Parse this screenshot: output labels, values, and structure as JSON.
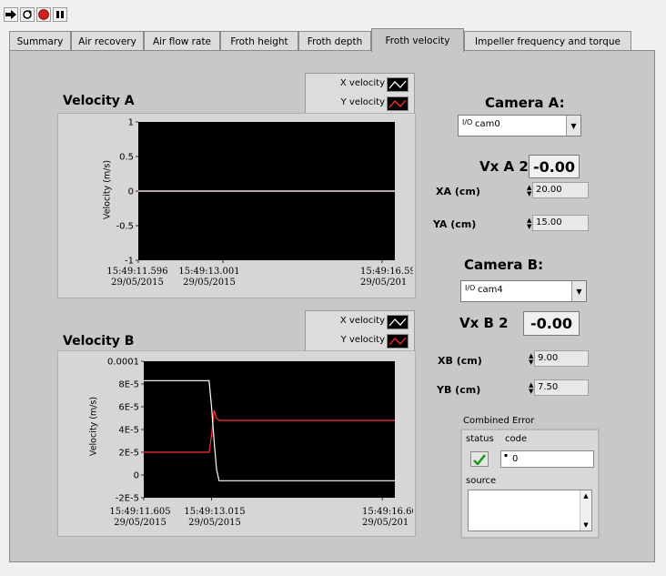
{
  "toolbar": {
    "run_icon": "run-arrow-icon",
    "run_cont_icon": "run-continuously-icon",
    "abort_icon": "abort-icon",
    "pause_icon": "pause-icon"
  },
  "tabs": [
    {
      "label": "Summary"
    },
    {
      "label": "Air recovery"
    },
    {
      "label": "Air flow rate"
    },
    {
      "label": "Froth height"
    },
    {
      "label": "Froth depth"
    },
    {
      "label": "Froth velocity"
    },
    {
      "label": "Impeller frequency and torque"
    }
  ],
  "active_tab": "Froth velocity",
  "velocity_a": {
    "title": "Velocity A",
    "legend": [
      "X velocity",
      "Y velocity"
    ],
    "ylabel": "Velocity (m/s)",
    "yticks": [
      "1",
      "0.5",
      "0",
      "-0.5",
      "-1"
    ],
    "xticks": [
      {
        "time": "15:49:11.596",
        "date": "29/05/2015"
      },
      {
        "time": "15:49:13.001",
        "date": "29/05/2015"
      },
      {
        "time": "15:49:16.59",
        "date": "29/05/201"
      }
    ]
  },
  "velocity_b": {
    "title": "Velocity B",
    "legend": [
      "X velocity",
      "Y velocity"
    ],
    "ylabel": "Velocity (m/s)",
    "yticks": [
      "0.0001",
      "8E-5",
      "6E-5",
      "4E-5",
      "2E-5",
      "0",
      "-2E-5"
    ],
    "xticks": [
      {
        "time": "15:49:11.605",
        "date": "29/05/2015"
      },
      {
        "time": "15:49:13.015",
        "date": "29/05/2015"
      },
      {
        "time": "15:49:16.60",
        "date": "29/05/201"
      }
    ]
  },
  "camera_a": {
    "label": "Camera A:",
    "value": "cam0",
    "prefix": "I/O",
    "vx_label": "Vx A 2",
    "vx_value": "-0.00",
    "x_label": "XA (cm)",
    "x_value": "20.00",
    "y_label": "YA (cm)",
    "y_value": "15.00"
  },
  "camera_b": {
    "label": "Camera B:",
    "value": "cam4",
    "prefix": "I/O",
    "vx_label": "Vx B 2",
    "vx_value": "-0.00",
    "x_label": "XB (cm)",
    "x_value": "9.00",
    "y_label": "YB (cm)",
    "y_value": "7.50"
  },
  "error": {
    "title": "Combined Error",
    "status_label": "status",
    "code_label": "code",
    "code_value": "0",
    "source_label": "source"
  },
  "chart_data": [
    {
      "type": "line",
      "title": "Velocity A",
      "ylabel": "Velocity (m/s)",
      "ylim": [
        -1,
        1
      ],
      "x": [
        "15:49:11.596",
        "15:49:16.59"
      ],
      "series": [
        {
          "name": "X velocity",
          "values": [
            0,
            0
          ],
          "color": "#ffffff"
        },
        {
          "name": "Y velocity",
          "values": [
            0,
            0
          ],
          "color": "#ff3030"
        }
      ]
    },
    {
      "type": "line",
      "title": "Velocity B",
      "ylabel": "Velocity (m/s)",
      "ylim": [
        -2e-05,
        0.0001
      ],
      "x": [
        0,
        0.26,
        0.27,
        0.28,
        0.29,
        0.3,
        0.32,
        1.0
      ],
      "series": [
        {
          "name": "X velocity",
          "values": [
            8.3e-05,
            8.3e-05,
            6e-05,
            3e-05,
            5e-06,
            -5e-06,
            -5e-06,
            -5e-06
          ],
          "color": "#ffffff"
        },
        {
          "name": "Y velocity",
          "values": [
            2e-05,
            2e-05,
            3.5e-05,
            5.7e-05,
            5e-05,
            4.8e-05,
            4.8e-05,
            4.8e-05
          ],
          "color": "#ff3030"
        }
      ]
    }
  ]
}
